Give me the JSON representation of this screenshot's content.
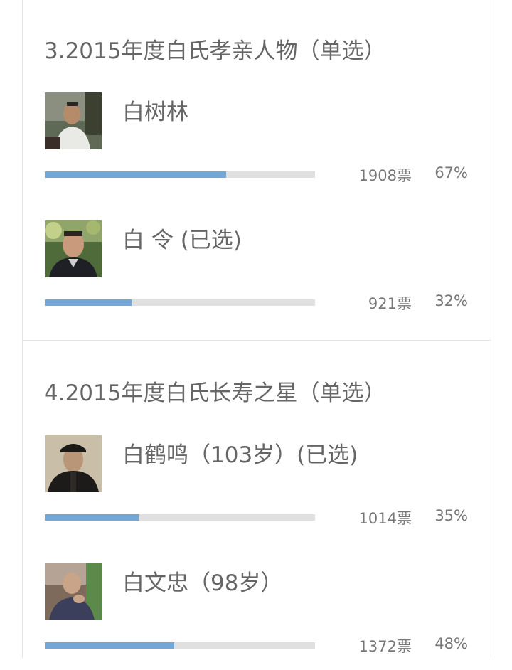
{
  "questions": [
    {
      "title": "3.2015年度白氏孝亲人物（单选）",
      "options": [
        {
          "name": "白树林",
          "votes": "1908票",
          "percent": "67%",
          "fraction": 0.67
        },
        {
          "name": "白 令 (已选)",
          "votes": "921票",
          "percent": "32%",
          "fraction": 0.32
        }
      ]
    },
    {
      "title": "4.2015年度白氏长寿之星（单选）",
      "options": [
        {
          "name": "白鹤鸣（103岁）(已选)",
          "votes": "1014票",
          "percent": "35%",
          "fraction": 0.35
        },
        {
          "name": "白文忠（98岁）",
          "votes": "1372票",
          "percent": "48%",
          "fraction": 0.48
        }
      ]
    }
  ],
  "colors": {
    "bar_fill": "#72a7d8",
    "bar_track": "#e0e0e0",
    "text": "#666666",
    "divider": "#e4e4e4"
  }
}
